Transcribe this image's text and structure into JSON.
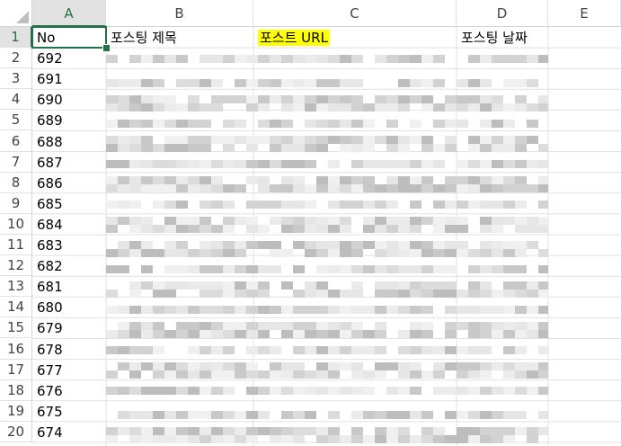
{
  "columns": [
    "A",
    "B",
    "C",
    "D",
    "E"
  ],
  "row_numbers": [
    "1",
    "2",
    "3",
    "4",
    "5",
    "6",
    "7",
    "8",
    "9",
    "10",
    "11",
    "12",
    "13",
    "14",
    "15",
    "16",
    "17",
    "18",
    "19",
    "20"
  ],
  "header_row": {
    "a": "No",
    "b": "포스팅 제목",
    "c": "포스트 URL",
    "d": "포스팅 날짜"
  },
  "no_values": [
    "692",
    "691",
    "690",
    "689",
    "688",
    "687",
    "686",
    "685",
    "684",
    "683",
    "682",
    "681",
    "680",
    "679",
    "678",
    "677",
    "676",
    "675",
    "674"
  ],
  "colors": {
    "selection_accent": "#217346",
    "url_highlight": "#ffff00",
    "gridline": "#e1e1e1"
  },
  "selected_cell": "A1"
}
